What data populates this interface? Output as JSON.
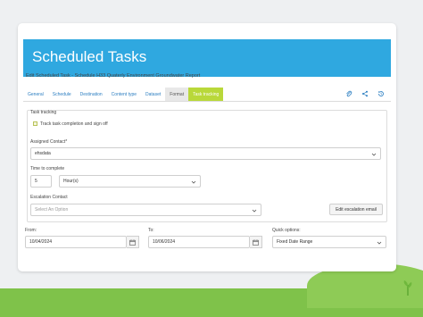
{
  "header": {
    "title": "Scheduled Tasks"
  },
  "edit_title": "Edit Scheduled Task - Schedule H33 Quaterly Environment Groundwater Report",
  "tabs": [
    {
      "label": "General"
    },
    {
      "label": "Schedule"
    },
    {
      "label": "Destination"
    },
    {
      "label": "Content type"
    },
    {
      "label": "Dataset"
    },
    {
      "label": "Format"
    },
    {
      "label": "Task tracking"
    }
  ],
  "task_tracking": {
    "legend": "Task tracking",
    "checkbox_label": "Track task completion and sign off",
    "assigned_contact_label": "Assigned Contact*",
    "assigned_contact_value": "ehsdata",
    "time_label": "Time to complete",
    "time_value": "5",
    "time_unit": "Hour(s)",
    "escalation_label": "Escalation Contact",
    "escalation_placeholder": "Select An Option",
    "edit_escalation_label": "Edit escalation email"
  },
  "dates": {
    "from_label": "From:",
    "from_value": "10/04/2024",
    "to_label": "To:",
    "to_value": "10/06/2024",
    "quick_label": "Quick options:",
    "quick_value": "Fixed Date Range"
  },
  "colors": {
    "header": "#2fa8e0",
    "active_tab": "#b9d83a",
    "link": "#2b7ec1",
    "grass": "#7fc24a"
  },
  "icons": [
    "paperclip-icon",
    "share-icon",
    "history-icon",
    "chevron-down-icon",
    "calendar-icon"
  ]
}
